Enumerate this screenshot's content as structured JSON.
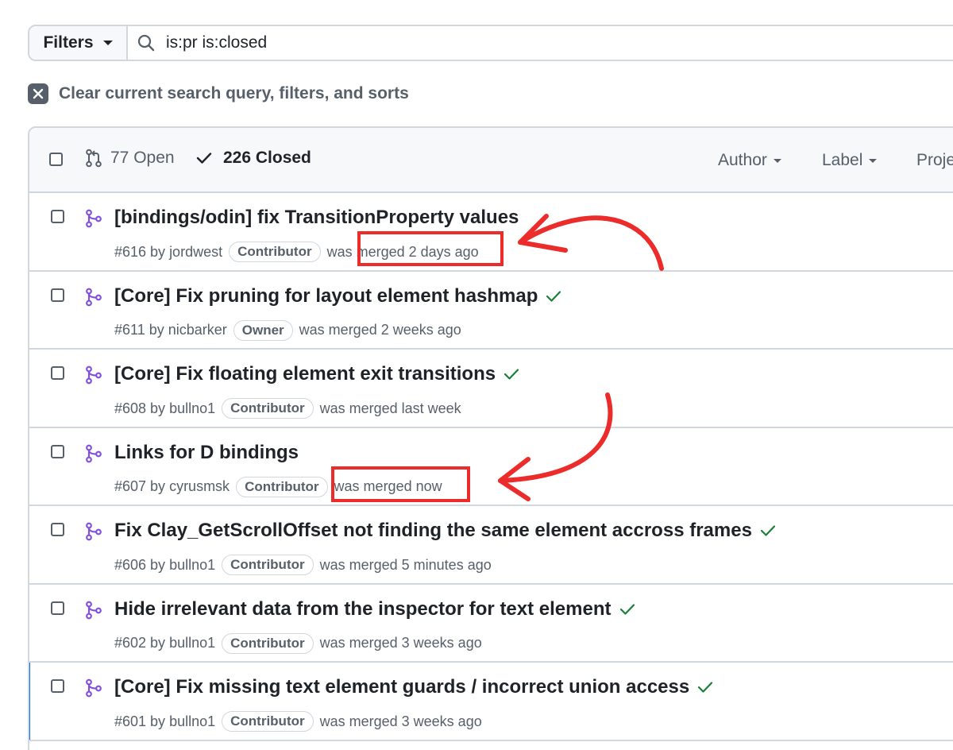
{
  "search": {
    "filters_label": "Filters",
    "query": "is:pr is:closed"
  },
  "clear_label": "Clear current search query, filters, and sorts",
  "header": {
    "open_label": "77 Open",
    "closed_label": "226 Closed",
    "author_label": "Author",
    "label_label": "Label",
    "projects_label": "Proje"
  },
  "prs": [
    {
      "title": "[bindings/odin] fix TransitionProperty values",
      "number": "#616",
      "by": "by",
      "author": "jordwest",
      "role": "Contributor",
      "status": "was merged 2 days ago",
      "check": false
    },
    {
      "title": "[Core] Fix pruning for layout element hashmap",
      "number": "#611",
      "by": "by",
      "author": "nicbarker",
      "role": "Owner",
      "status": "was merged 2 weeks ago",
      "check": true
    },
    {
      "title": "[Core] Fix floating element exit transitions",
      "number": "#608",
      "by": "by",
      "author": "bullno1",
      "role": "Contributor",
      "status": "was merged last week",
      "check": true
    },
    {
      "title": "Links for D bindings",
      "number": "#607",
      "by": "by",
      "author": "cyrusmsk",
      "role": "Contributor",
      "status": "was merged now",
      "check": false
    },
    {
      "title": "Fix Clay_GetScrollOffset not finding the same element accross frames",
      "number": "#606",
      "by": "by",
      "author": "bullno1",
      "role": "Contributor",
      "status": "was merged 5 minutes ago",
      "check": true
    },
    {
      "title": "Hide irrelevant data from the inspector for text element",
      "number": "#602",
      "by": "by",
      "author": "bullno1",
      "role": "Contributor",
      "status": "was merged 3 weeks ago",
      "check": true
    },
    {
      "title": "[Core] Fix missing text element guards / incorrect union access",
      "number": "#601",
      "by": "by",
      "author": "bullno1",
      "role": "Contributor",
      "status": "was merged 3 weeks ago",
      "check": true
    }
  ],
  "colors": {
    "merged_purple": "#8250df",
    "success_green": "#1a7f37",
    "annotation_red": "#ec2b2b"
  }
}
